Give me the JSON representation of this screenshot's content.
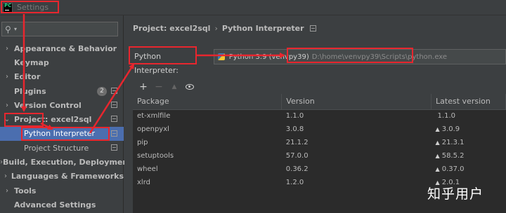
{
  "window": {
    "title": "Settings"
  },
  "sidebar": {
    "search_placeholder": "",
    "items": [
      {
        "label": "Appearance & Behavior",
        "arrow": "›"
      },
      {
        "label": "Keymap",
        "arrow": ""
      },
      {
        "label": "Editor",
        "arrow": "›"
      },
      {
        "label": "Plugins",
        "arrow": "",
        "badge": "2"
      },
      {
        "label": "Version Control",
        "arrow": "›"
      },
      {
        "label": "Project: excel2sql",
        "arrow": "⌄"
      },
      {
        "label": "Python Interpreter"
      },
      {
        "label": "Project Structure"
      },
      {
        "label": "Build, Execution, Deployment",
        "arrow": "›"
      },
      {
        "label": "Languages & Frameworks",
        "arrow": "›"
      },
      {
        "label": "Tools",
        "arrow": "›"
      },
      {
        "label": "Advanced Settings",
        "arrow": ""
      }
    ]
  },
  "breadcrumb": {
    "project": "Project: excel2sql",
    "separator": "›",
    "page": "Python Interpreter"
  },
  "interpreter": {
    "label": "Python Interpreter:",
    "name": "Python 3.9 (venvpy39)",
    "path": "D:\\home\\venvpy39\\Scripts\\python.exe"
  },
  "toolbar": {
    "add": "+",
    "remove": "−",
    "upgrade": "▲"
  },
  "packages": {
    "headers": [
      "Package",
      "Version",
      "Latest version"
    ],
    "rows": [
      {
        "package": "et-xmlfile",
        "version": "1.1.0",
        "latest": "1.1.0",
        "upgrade": ""
      },
      {
        "package": "openpyxl",
        "version": "3.0.8",
        "latest": "3.0.9",
        "upgrade": "▲"
      },
      {
        "package": "pip",
        "version": "21.1.2",
        "latest": "21.3.1",
        "upgrade": "▲"
      },
      {
        "package": "setuptools",
        "version": "57.0.0",
        "latest": "58.5.2",
        "upgrade": "▲"
      },
      {
        "package": "wheel",
        "version": "0.36.2",
        "latest": "0.37.0",
        "upgrade": "▲"
      },
      {
        "package": "xlrd",
        "version": "1.2.0",
        "latest": "2.0.1",
        "upgrade": "▲"
      }
    ]
  },
  "watermark": "知乎用户",
  "colors": {
    "background": "#3c3f41",
    "table": "#2b2b2b",
    "selection": "#4b6eaf",
    "annotation": "#e8262e"
  }
}
